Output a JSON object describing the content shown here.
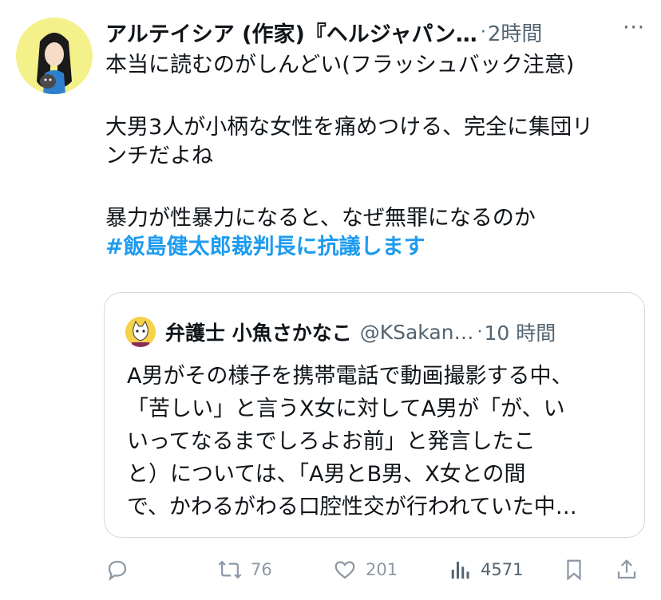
{
  "tweet": {
    "author": "アルテイシア (作家)『ヘルジャパン…",
    "time": "2時間",
    "more": "···",
    "lines": [
      "本当に読むのがしんどい(フラッシュバック注意)",
      "",
      "大男3人が小柄な女性を痛めつける、完全に集団リ",
      "ンチだよね",
      "",
      "暴力が性暴力になると、なぜ無罪になるのか"
    ],
    "hashtag": "#飯島健太郎裁判長に抗議します"
  },
  "quote": {
    "name": "弁護士 小魚さかなこ",
    "handle": "@KSakan…",
    "time": "10 時間",
    "lines": [
      "A男がその様子を携帯電話で動画撮影する中、",
      "「苦しい」と言うX女に対してA男が「が、い",
      "いってなるまでしろよお前」と発言したこ",
      "と）については、「A男とB男、X女との間",
      "で、かわるがわる口腔性交が行われていた中…"
    ]
  },
  "actions": {
    "reply": {
      "icon": "reply-icon",
      "count": ""
    },
    "retweet": {
      "icon": "retweet-icon",
      "count": "76"
    },
    "like": {
      "icon": "heart-icon",
      "count": "201"
    },
    "views": {
      "icon": "views-icon",
      "count": "4571"
    },
    "bookmark": {
      "icon": "bookmark-icon"
    },
    "share": {
      "icon": "share-icon"
    }
  },
  "colors": {
    "hashtag": "#1d9bf0",
    "secondary_text": "#536471",
    "action_icon": "#8b98a5",
    "border": "#cfd9de",
    "avatar_bg": "#f4f08a"
  }
}
